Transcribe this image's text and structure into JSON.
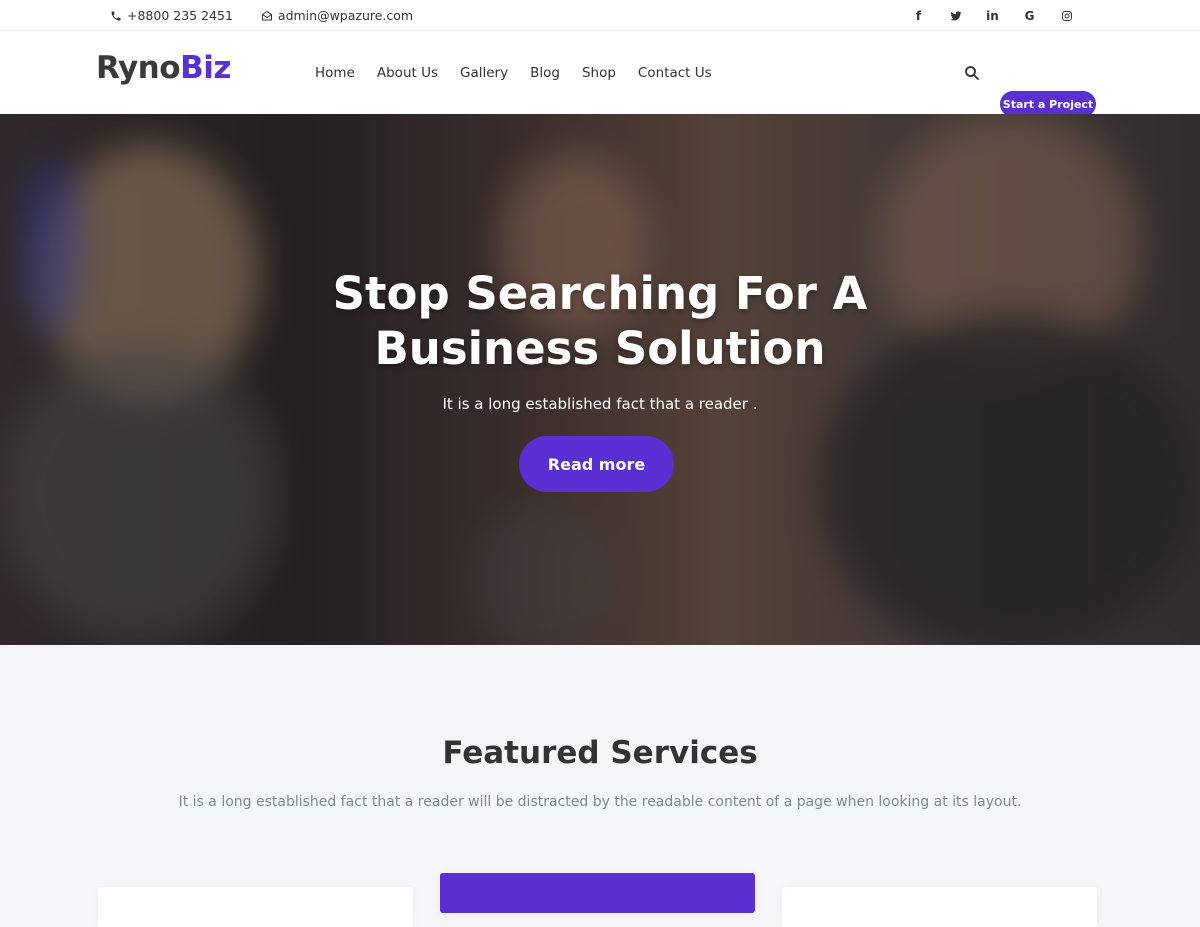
{
  "topbar": {
    "phone": "+8800 235 2451",
    "email": "admin@wpazure.com",
    "social": [
      "facebook-icon",
      "twitter-icon",
      "linkedin-icon",
      "google-icon",
      "instagram-icon"
    ]
  },
  "brand": {
    "part1": "Ryno",
    "part2": "Biz",
    "accent": "#5a2fd3"
  },
  "nav": [
    "Home",
    "About Us",
    "Gallery",
    "Blog",
    "Shop",
    "Contact Us"
  ],
  "header": {
    "cta": "Start a Project"
  },
  "hero": {
    "title_line1": "Stop Searching For A",
    "title_line2": "Business Solution",
    "subtitle": "It is a long established fact that a reader .",
    "button": "Read more"
  },
  "services": {
    "title": "Featured Services",
    "subtitle": "It is a long established fact that a reader will be distracted by the readable content of a page when looking at its layout."
  }
}
